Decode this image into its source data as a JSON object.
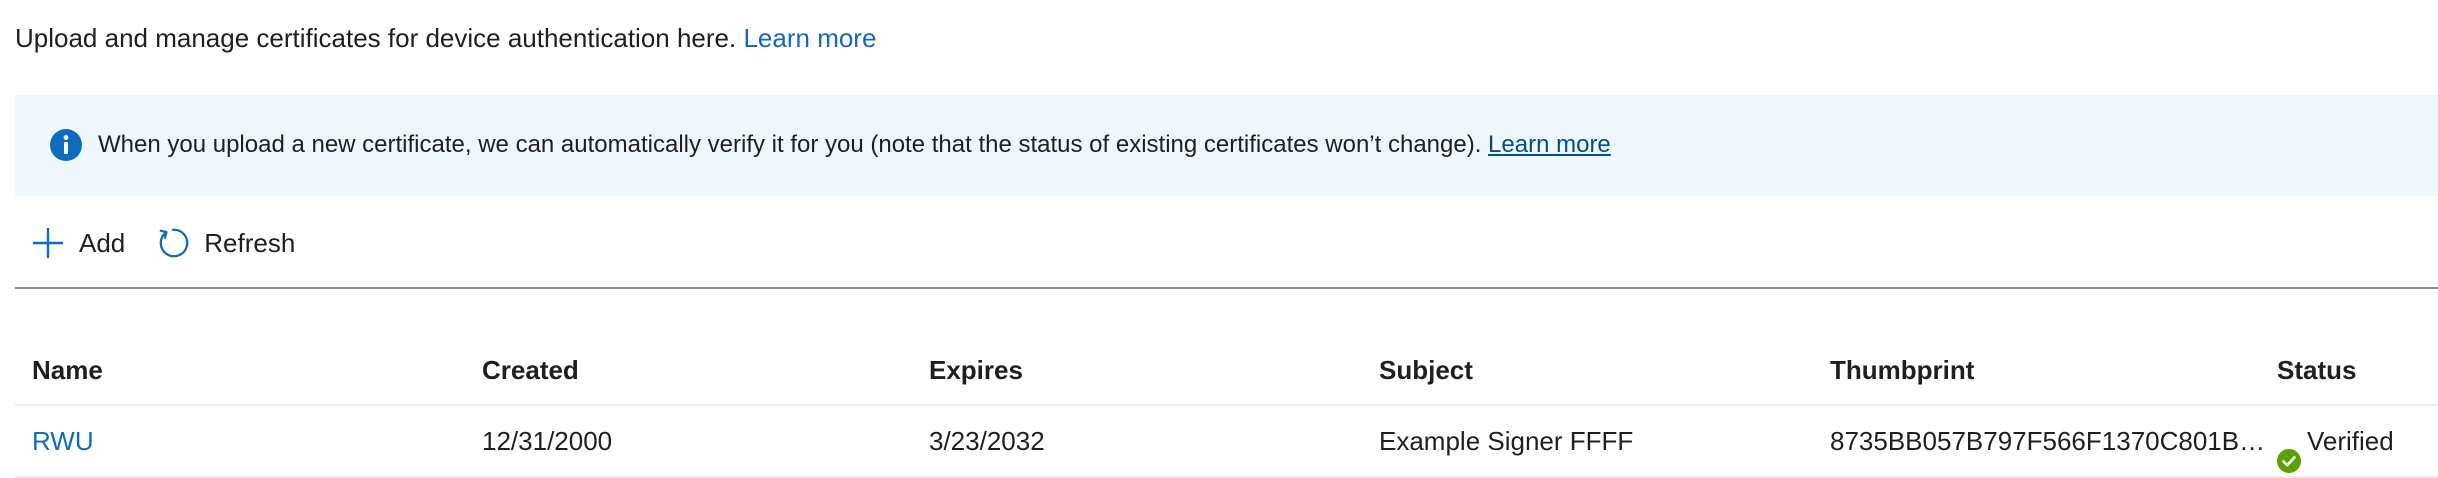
{
  "intro": {
    "text": "Upload and manage certificates for device authentication here.",
    "learn_more": "Learn more"
  },
  "banner": {
    "icon": "info-icon",
    "text": "When you upload a new certificate, we can automatically verify it for you (note that the status of existing certificates won’t change).",
    "learn_more": " Learn more",
    "bg_color": "#eff6fc",
    "icon_color": "#0f6cbd"
  },
  "toolbar": {
    "add_label": "Add",
    "add_icon": "plus-icon",
    "refresh_label": "Refresh",
    "refresh_icon": "refresh-icon"
  },
  "table": {
    "columns": [
      "Name",
      "Created",
      "Expires",
      "Subject",
      "Thumbprint",
      "Status"
    ],
    "rows": [
      {
        "name": "RWU",
        "created": "12/31/2000",
        "expires": "3/23/2032",
        "subject": "Example Signer FFFF",
        "thumbprint": "8735BB057B797F566F1370C801B3E...",
        "status": "Verified",
        "status_icon": "check-circle-icon",
        "status_color": "#57a300"
      }
    ]
  },
  "colors": {
    "link": "#0f6cbd",
    "text": "#201f1e"
  }
}
